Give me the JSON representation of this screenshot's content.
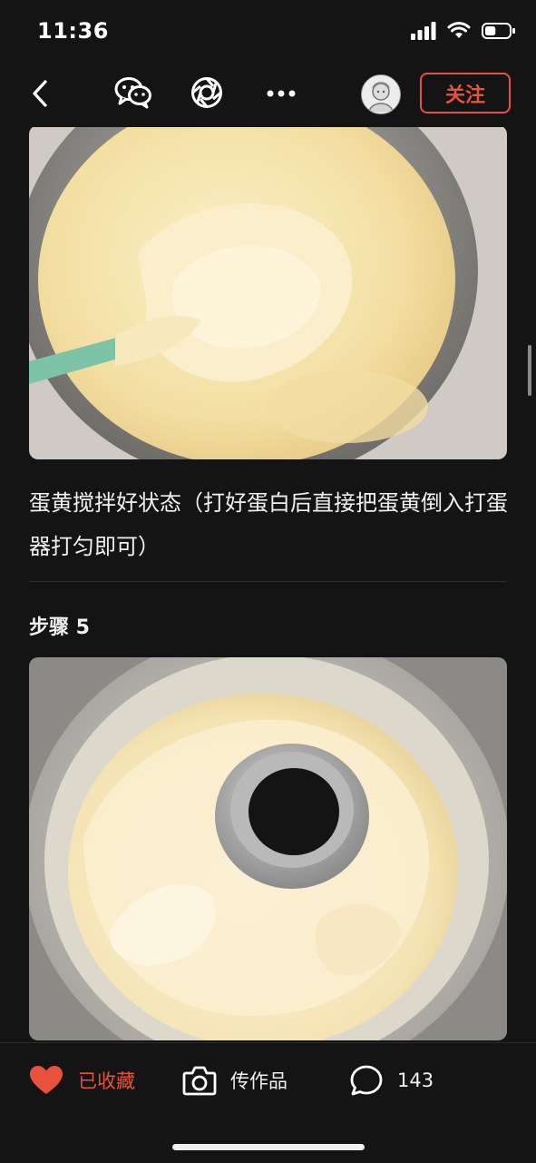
{
  "status_bar": {
    "time": "11:36",
    "battery_level": 0.45
  },
  "nav": {
    "back_icon": "chevron-left-icon",
    "share_icons": [
      "wechat-icon",
      "moments-icon",
      "more-icon"
    ],
    "follow_label": "关注"
  },
  "content": {
    "step4_caption": "蛋黄搅拌好状态（打好蛋白后直接把蛋黄倒入打蛋器打匀即可）",
    "step5_title": "步骤 5"
  },
  "bottom_bar": {
    "favorite_label": "已收藏",
    "upload_label": "传作品",
    "comment_count": "143"
  },
  "colors": {
    "accent": "#e8523c",
    "background": "#141414"
  }
}
